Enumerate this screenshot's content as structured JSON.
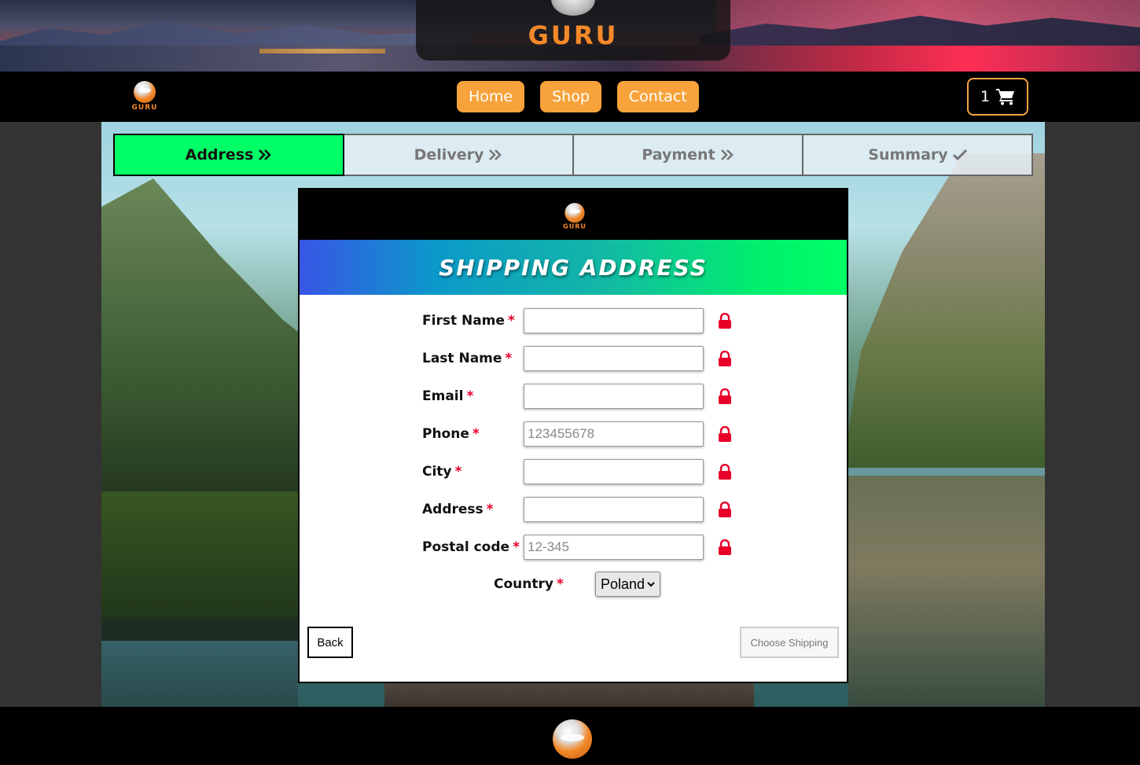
{
  "hero": {
    "logo_text": "GURU"
  },
  "navbar": {
    "brand_text": "GURU",
    "links": [
      {
        "label": "Home"
      },
      {
        "label": "Shop"
      },
      {
        "label": "Contact"
      }
    ],
    "cart_count": "1",
    "cart_icon": "shopping-cart-icon",
    "accent_color": "#f7a23a"
  },
  "steps": [
    {
      "label": "Address",
      "icon": "double-chevron-right-icon",
      "state": "active"
    },
    {
      "label": "Delivery",
      "icon": "double-chevron-right-icon",
      "state": "inactive"
    },
    {
      "label": "Payment",
      "icon": "double-chevron-right-icon",
      "state": "inactive"
    },
    {
      "label": "Summary",
      "icon": "check-icon",
      "state": "inactive"
    }
  ],
  "card": {
    "logo_text": "GURU",
    "title": "SHIPPING ADDRESS",
    "required_marker": "*",
    "fields": [
      {
        "label": "First Name",
        "value": "",
        "placeholder": ""
      },
      {
        "label": "Last Name",
        "value": "",
        "placeholder": ""
      },
      {
        "label": "Email",
        "value": "",
        "placeholder": ""
      },
      {
        "label": "Phone",
        "value": "",
        "placeholder": "123455678"
      },
      {
        "label": "City",
        "value": "",
        "placeholder": ""
      },
      {
        "label": "Address",
        "value": "",
        "placeholder": ""
      },
      {
        "label": "Postal code",
        "value": "",
        "placeholder": "12-345"
      }
    ],
    "lock_icon": "lock-icon",
    "lock_color": "#e8002a",
    "country": {
      "label": "Country",
      "selected": "Poland"
    },
    "back_label": "Back",
    "next_label": "Choose Shipping"
  },
  "colors": {
    "active_step": "#00ff66",
    "banner_gradient": [
      "#3855e6",
      "#00ff66"
    ],
    "required": "#e8002a"
  }
}
